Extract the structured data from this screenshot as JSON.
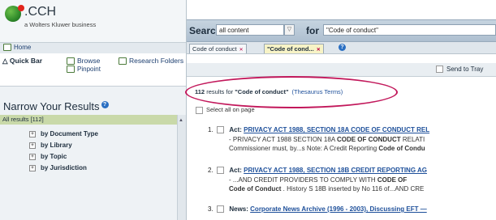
{
  "brand": {
    "logo_text": ".CCH",
    "logo_sub": "a Wolters Kluwer business"
  },
  "nav": {
    "home": "Home",
    "quickbar": "Quick Bar",
    "browse": "Browse",
    "pinpoint": "Pinpoint",
    "research": "Research Folders"
  },
  "narrow": {
    "title": "Narrow Your Results",
    "all_results": "All results [112]",
    "facets": [
      "by Document Type",
      "by Library",
      "by Topic",
      "by Jurisdiction"
    ]
  },
  "search": {
    "label": "Search",
    "scope": "all content",
    "for_label": "for",
    "query": "\"Code of conduct\""
  },
  "doc_tabs": [
    "Code of conduct",
    "\"Code of cond..."
  ],
  "toolbar": {
    "send_to_tray": "Send to Tray"
  },
  "results": {
    "count": "112",
    "text": "results for",
    "query": "\"Code of conduct\"",
    "thesaurus": "(Thesaurus Terms)",
    "select_all": "Select all on page",
    "items": [
      {
        "num": "1.",
        "type": "Act:",
        "title": "PRIVACY ACT 1988, SECTION 18A CODE OF CONDUCT REL",
        "line1_pre": "- PRIVACY ACT 1988 SECTION 18A ",
        "line1_bold": "CODE OF CONDUCT",
        "line1_post": " RELATI",
        "line2_pre": "Commissioner must, by...s Note: A Credit Reporting ",
        "line2_bold": "Code of Condu",
        "line2_post": ""
      },
      {
        "num": "2.",
        "type": "Act:",
        "title": "PRIVACY ACT 1988, SECTION 18B CREDIT REPORTING AG",
        "line1_pre": "- ...AND CREDIT PROVIDERS TO COMPLY WITH ",
        "line1_bold": "CODE OF",
        "line1_post": "",
        "line2_pre": "",
        "line2_bold": "Code of Conduct",
        "line2_post": " . History S 18B inserted by No 116 of...AND CRE"
      },
      {
        "num": "3.",
        "type": "News:",
        "title": "Corporate News Archive (1996 - 2003), Discussing EFT —",
        "line1_pre": "",
        "line1_bold": "",
        "line1_post": "",
        "line2_pre": "",
        "line2_bold": "",
        "line2_post": ""
      }
    ]
  }
}
